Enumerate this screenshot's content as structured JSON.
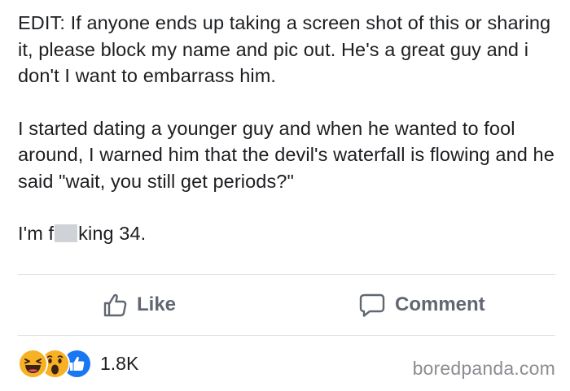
{
  "post": {
    "paragraphs": [
      "EDIT: If anyone ends up taking a screen shot of this or sharing it, please block my name and pic out. He's a great guy and i don't I want to embarrass him.",
      "I started dating a younger guy and when he wanted to fool around, I warned him that the devil's waterfall is flowing and he said \"wait, you still get periods?\""
    ],
    "last_line_prefix": "I'm f",
    "last_line_suffix": "king 34."
  },
  "actions": {
    "like_label": "Like",
    "comment_label": "Comment",
    "like_icon": "thumbs-up-icon",
    "comment_icon": "speech-bubble-icon"
  },
  "reactions": {
    "icons": [
      "haha-reaction-icon",
      "wow-reaction-icon",
      "like-reaction-icon"
    ],
    "count": "1.8K"
  },
  "watermark": "boredpanda.com",
  "colors": {
    "text": "#1c1e21",
    "action_text": "#606770",
    "divider": "#dadde1",
    "like_blue": "#1877f2",
    "reaction_yellow": "#f7b125",
    "watermark": "#8a8d91",
    "censor": "#cfd2d6"
  }
}
